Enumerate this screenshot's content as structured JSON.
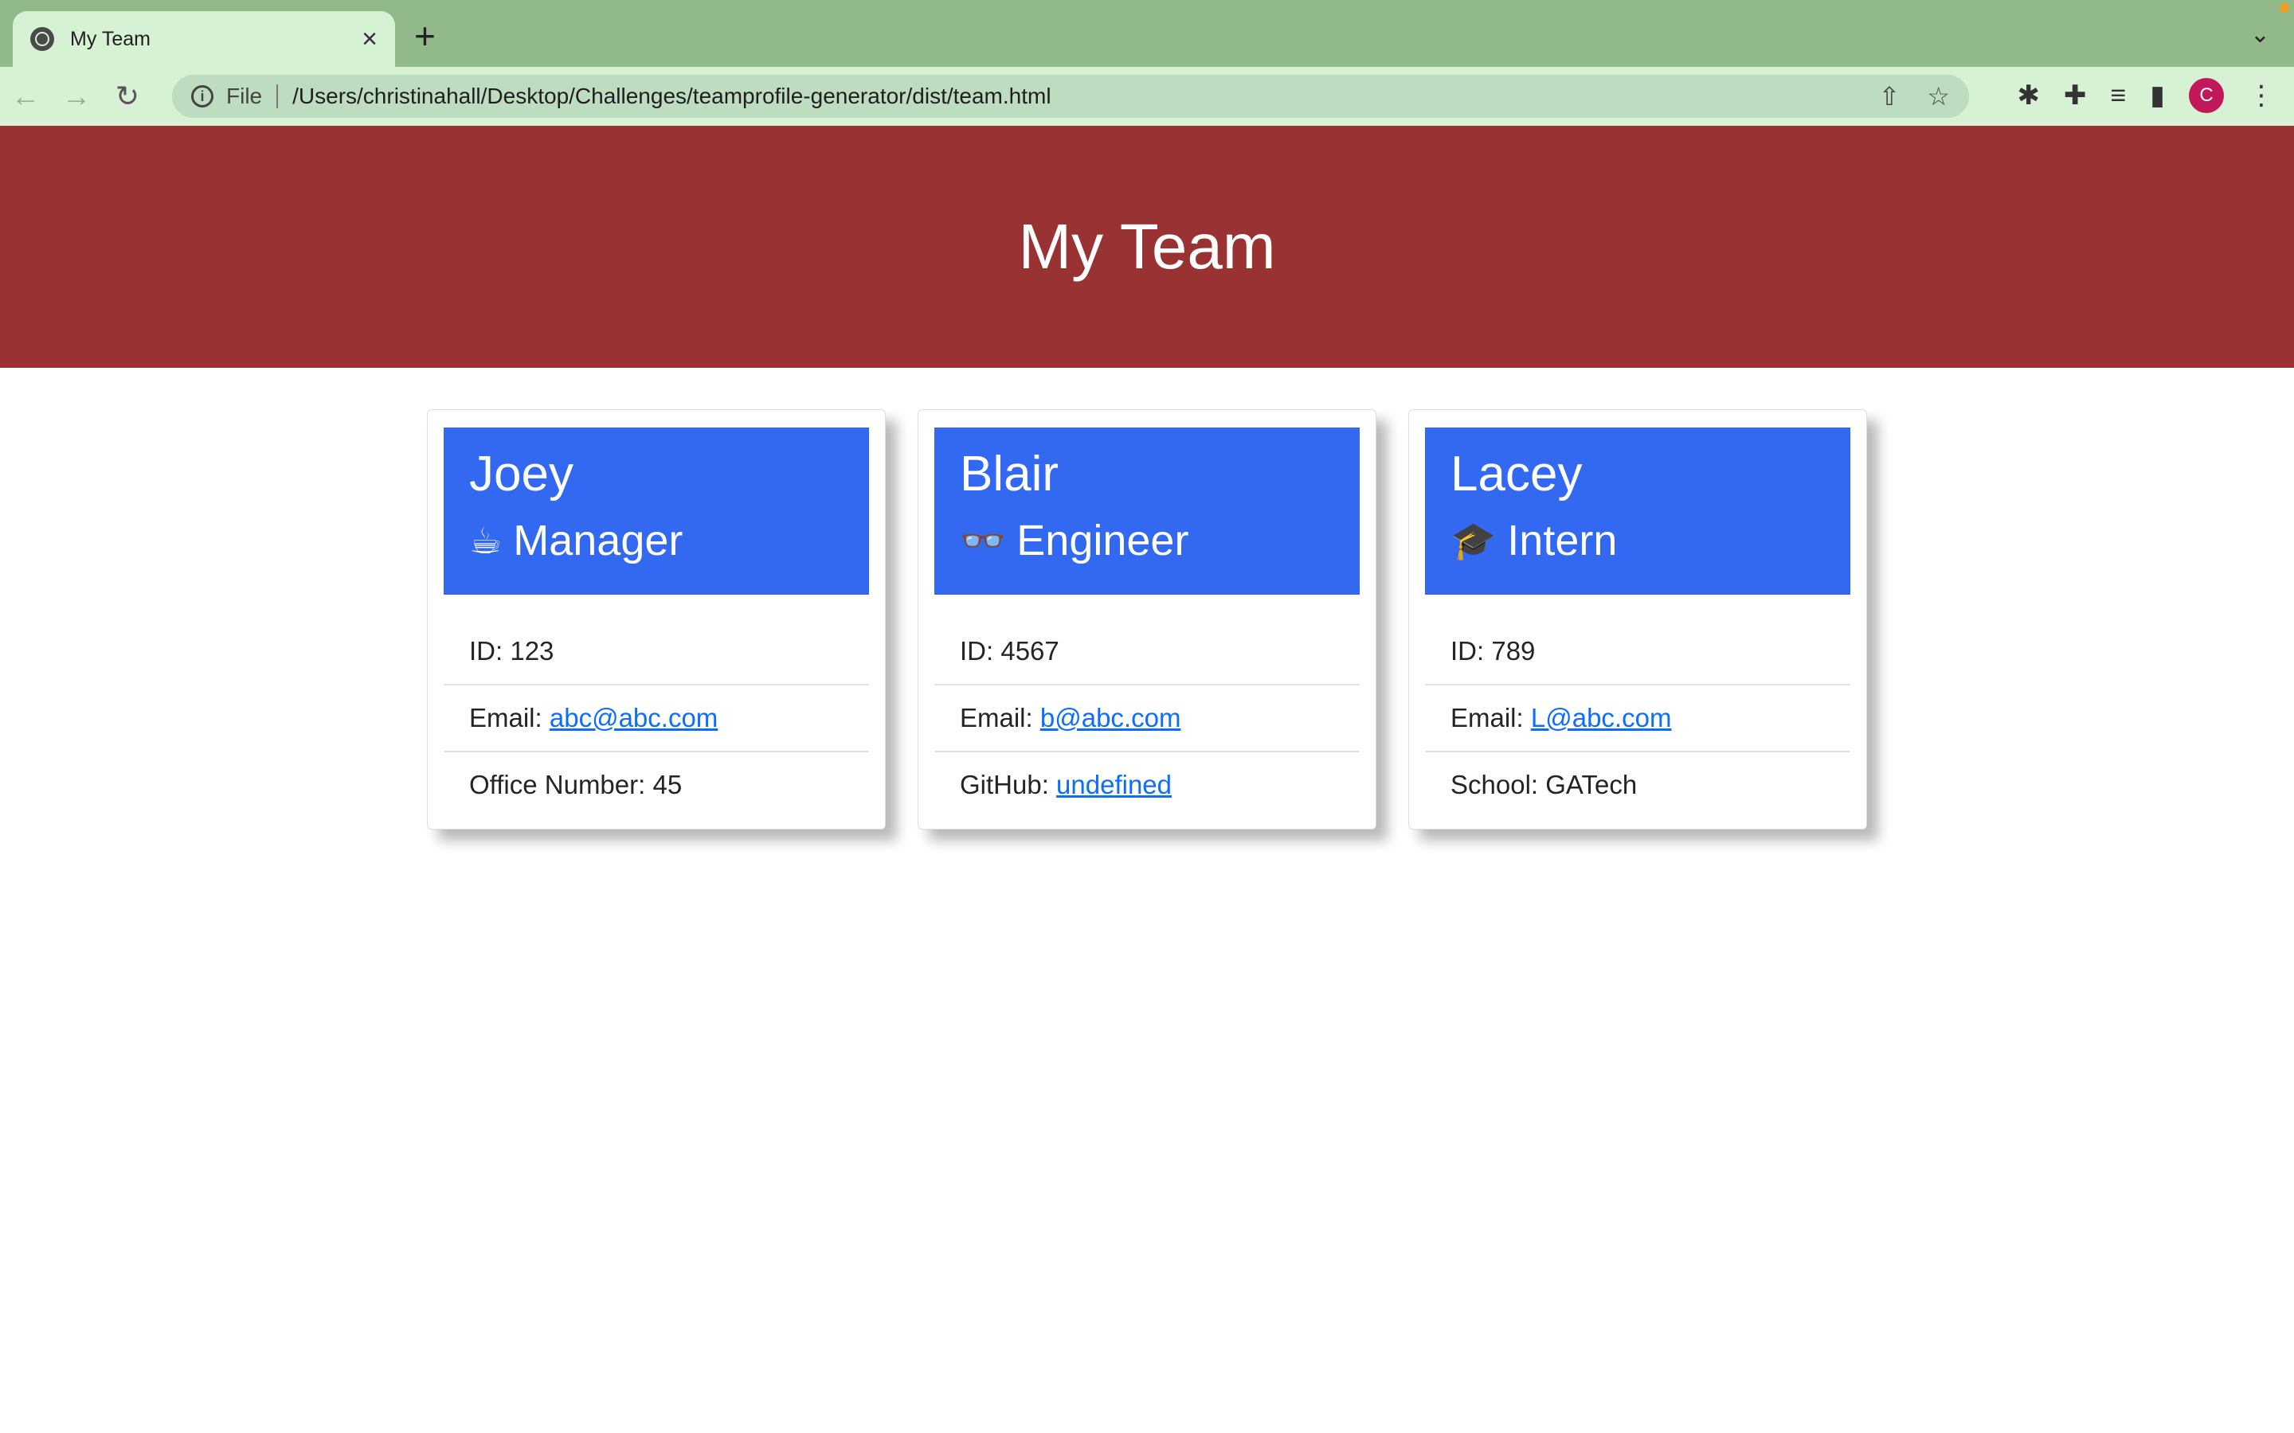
{
  "browser": {
    "tab_title": "My Team",
    "tab_close_icon": "close-icon",
    "new_tab_icon": "plus-icon",
    "omnibox": {
      "scheme_label": "File",
      "url": "/Users/christinahall/Desktop/Challenges/teamprofile-generator/dist/team.html"
    },
    "profile_initial": "C"
  },
  "page": {
    "title": "My Team",
    "colors": {
      "header": "#993333",
      "card_header": "#3369f0",
      "link": "#0d6efd"
    },
    "cards": [
      {
        "name": "Joey",
        "role_icon": "☕",
        "role": "Manager",
        "id_label": "ID: 123",
        "email_prefix": "Email: ",
        "email": "abc@abc.com",
        "extra_prefix": "Office Number: 45"
      },
      {
        "name": "Blair",
        "role_icon": "👓",
        "role": "Engineer",
        "id_label": "ID: 4567",
        "email_prefix": "Email: ",
        "email": "b@abc.com",
        "extra_prefix": "GitHub: ",
        "extra_link": "undefined"
      },
      {
        "name": "Lacey",
        "role_icon": "🎓",
        "role": "Intern",
        "id_label": "ID: 789",
        "email_prefix": "Email: ",
        "email": "L@abc.com",
        "extra_prefix": "School: GATech"
      }
    ]
  }
}
